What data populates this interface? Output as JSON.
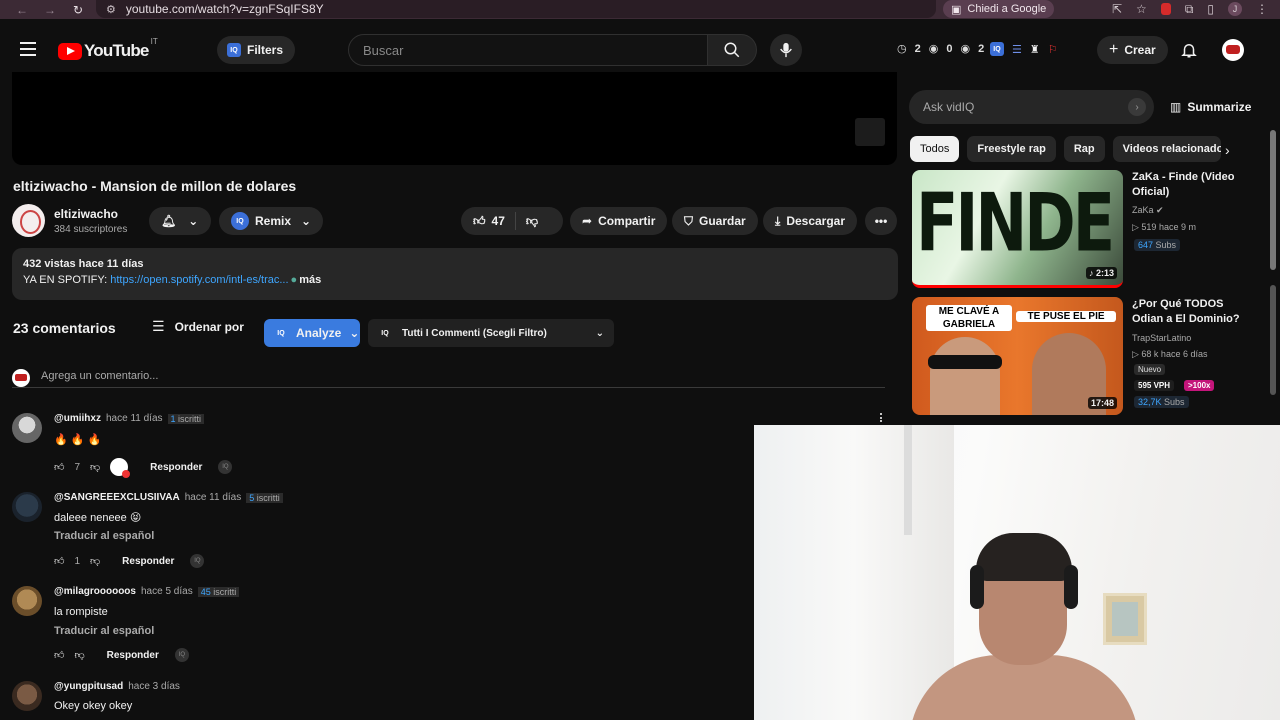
{
  "browser": {
    "url": "youtube.com/watch?v=zgnFSqIFS8Y",
    "ask_google": "Chiedi a Google",
    "profile_initial": "J"
  },
  "header": {
    "logo_text": "YouTube",
    "logo_region": "IT",
    "filters_label": "Filters",
    "search_placeholder": "Buscar",
    "stats": {
      "a": "2",
      "b": "0",
      "c": "2"
    },
    "create_label": "Crear"
  },
  "video": {
    "title": "eltiziwacho - Mansion de millon de dolares",
    "channel_name": "eltiziwacho",
    "channel_subs": "384 suscriptores",
    "remix_label": "Remix",
    "likes": "47",
    "share_label": "Compartir",
    "save_label": "Guardar",
    "download_label": "Descargar"
  },
  "description": {
    "views_date": "432 vistas  hace 11 días",
    "spotify_prefix": "YA EN SPOTIFY: ",
    "spotify_link": "https://open.spotify.com/intl-es/trac...",
    "more": "más"
  },
  "comments_section": {
    "count_label": "23 comentarios",
    "sort_label": "Ordenar por",
    "analyze_label": "Analyze",
    "filter_label": "Tutti I Commenti (Scegli Filtro)",
    "add_placeholder": "Agrega un comentario...",
    "reply_label": "Responder",
    "translate_label": "Traducir al español"
  },
  "comments": [
    {
      "user": "@umiihxz",
      "time": "hace 11 días",
      "subs_num": "1",
      "subs_word": "iscritti",
      "text": "🔥 🔥 🔥",
      "likes": "7"
    },
    {
      "user": "@SANGREEEXCLUSIIVAA",
      "time": "hace 11 días",
      "subs_num": "5",
      "subs_word": "iscritti",
      "text": "daleee neneee 😝",
      "likes": "1"
    },
    {
      "user": "@milagroooooos",
      "time": "hace 5 días",
      "subs_num": "45",
      "subs_word": "iscritti",
      "text": "la rompiste",
      "likes": ""
    },
    {
      "user": "@yungpitusad",
      "time": "hace 3 días",
      "text": "Okey okey okey"
    }
  ],
  "sidebar": {
    "ask_placeholder": "Ask vidIQ",
    "summarize_label": "Summarize",
    "chips": [
      "Todos",
      "Freestyle rap",
      "Rap",
      "Videos relacionados"
    ],
    "related": [
      {
        "title": "ZaKa - Finde (Video Oficial)",
        "channel": "ZaKa",
        "stats": "▷ 519  hace 9 m",
        "subs_num": "647",
        "subs_word": "Subs",
        "duration": "2:13",
        "thumb_text": "FINDE"
      },
      {
        "title": "¿Por Qué TODOS Odian a El Dominio?",
        "channel": "TrapStarLatino",
        "stats": "▷ 68 k  hace 6 días",
        "tag": "Nuevo",
        "vph": "595 VPH",
        "pct": ">100x",
        "subs_num": "32,7K",
        "subs_word": "Subs",
        "duration": "17:48",
        "thumb_left": "ME CLAVÉ A GABRIELA",
        "thumb_right": "TE PUSE EL PIE"
      }
    ]
  },
  "colors": {
    "background": "#0f0f0f",
    "accent_blue": "#3ea6ff",
    "analyze_button": "#3a7bdf",
    "youtube_red": "#ff0000",
    "browser_chrome": "#3c2a35"
  }
}
